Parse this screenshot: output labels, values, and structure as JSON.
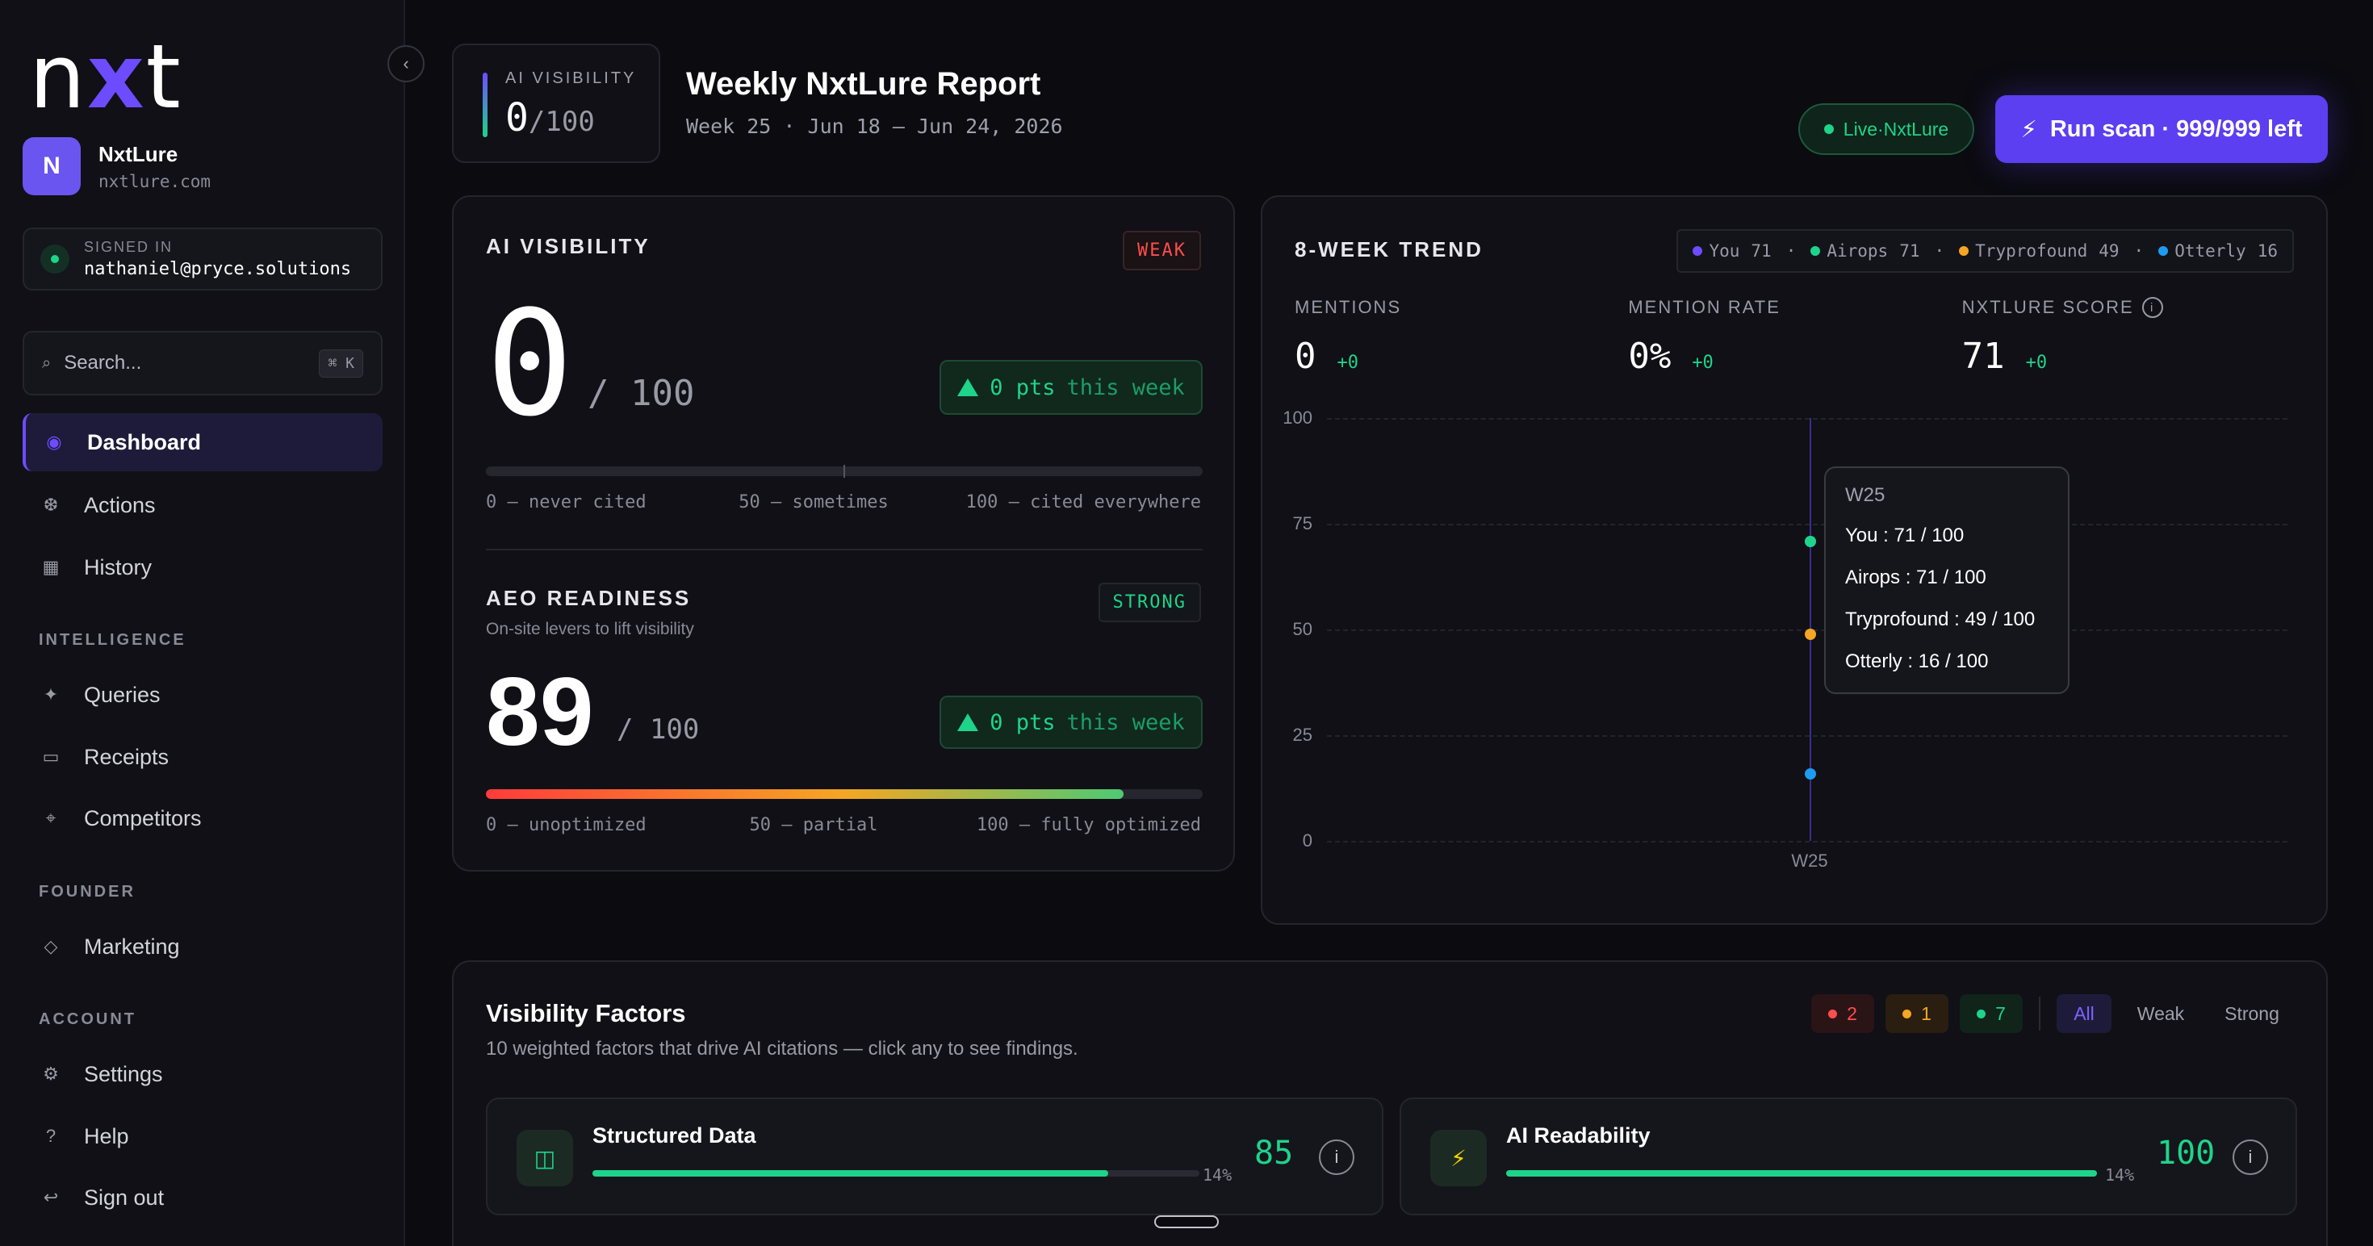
{
  "sidebar": {
    "logo": {
      "pre": "n",
      "mid": "x",
      "post": "t"
    },
    "org": {
      "initial": "N",
      "name": "NxtLure",
      "domain": "nxtlure.com"
    },
    "signed_in": {
      "label": "SIGNED IN",
      "email": "nathaniel@pryce.solutions"
    },
    "search": {
      "placeholder": "Search...",
      "shortcut": "⌘ K"
    },
    "nav": [
      {
        "label": "Dashboard",
        "icon": "dashboard-icon",
        "active": true
      },
      {
        "label": "Actions",
        "icon": "gear-icon"
      },
      {
        "label": "History",
        "icon": "history-icon"
      }
    ],
    "sections": {
      "intelligence": {
        "label": "INTELLIGENCE",
        "items": [
          {
            "label": "Queries"
          },
          {
            "label": "Receipts"
          },
          {
            "label": "Competitors"
          }
        ]
      },
      "founder": {
        "label": "FOUNDER",
        "items": [
          {
            "label": "Marketing"
          }
        ]
      },
      "account": {
        "label": "ACCOUNT",
        "items": [
          {
            "label": "Settings"
          },
          {
            "label": "Help"
          },
          {
            "label": "Sign out"
          }
        ]
      }
    }
  },
  "header": {
    "mini": {
      "label": "AI VISIBILITY",
      "value": "0",
      "max": "/100"
    },
    "title": "Weekly NxtLure Report",
    "subtitle": "Week 25 · Jun 18 — Jun 24, 2026",
    "live_label": "Live·NxtLure",
    "run_button": "Run scan · 999/999 left"
  },
  "ai_visibility": {
    "label": "AI VISIBILITY",
    "tag": "WEAK",
    "score": "0",
    "max": "/ 100",
    "delta_num": "0 pts",
    "delta_suffix": "this week",
    "progress": 0,
    "scale": [
      "0 — never cited",
      "50 — sometimes",
      "100 — cited everywhere"
    ]
  },
  "aeo": {
    "label": "AEO READINESS",
    "subtitle": "On-site levers to lift visibility",
    "tag": "STRONG",
    "score": "89",
    "max": "/ 100",
    "delta_num": "0 pts",
    "delta_suffix": "this week",
    "progress": 0.89,
    "scale": [
      "0 — unoptimized",
      "50 — partial",
      "100 — fully optimized"
    ]
  },
  "trend": {
    "label": "8-WEEK TREND",
    "legend": [
      {
        "name": "You",
        "value": "71",
        "color": "#6d4cff"
      },
      {
        "name": "Airops",
        "value": "71",
        "color": "#1ed48a"
      },
      {
        "name": "Tryprofound",
        "value": "49",
        "color": "#f5a623"
      },
      {
        "name": "Otterly",
        "value": "16",
        "color": "#1e9bf0"
      }
    ],
    "stats": [
      {
        "label": "MENTIONS",
        "value": "0",
        "delta": "+0"
      },
      {
        "label": "MENTION RATE",
        "value": "0%",
        "delta": "+0"
      },
      {
        "label": "NXTLURE SCORE",
        "value": "71",
        "delta": "+0"
      }
    ],
    "tooltip": {
      "week": "W25",
      "lines": [
        "You : 71 / 100",
        "Airops : 71 / 100",
        "Tryprofound : 49 / 100",
        "Otterly : 16 / 100"
      ]
    }
  },
  "chart_data": {
    "type": "scatter",
    "x": [
      "W25"
    ],
    "ylim": [
      0,
      100
    ],
    "yticks": [
      "100",
      "75",
      "50",
      "25",
      "0"
    ],
    "series": [
      {
        "name": "You",
        "values": [
          71
        ],
        "color": "#6d4cff"
      },
      {
        "name": "Airops",
        "values": [
          71
        ],
        "color": "#1ed48a"
      },
      {
        "name": "Tryprofound",
        "values": [
          49
        ],
        "color": "#f5a623"
      },
      {
        "name": "Otterly",
        "values": [
          16
        ],
        "color": "#1e9bf0"
      }
    ]
  },
  "factors": {
    "title": "Visibility Factors",
    "subtitle": "10 weighted factors that drive AI citations — click any to see findings.",
    "counts": [
      {
        "value": "2",
        "color": "#ff4d4d"
      },
      {
        "value": "1",
        "color": "#f5a623"
      },
      {
        "value": "7",
        "color": "#1ed48a"
      }
    ],
    "filters": [
      "All",
      "Weak",
      "Strong"
    ],
    "items": [
      {
        "name": "Structured Data",
        "score": "85",
        "weight": "14%",
        "progress": 0.85,
        "icon": "structured-data-icon"
      },
      {
        "name": "AI Readability",
        "score": "100",
        "weight": "14%",
        "progress": 1.0,
        "icon": "lightning-icon"
      }
    ]
  }
}
